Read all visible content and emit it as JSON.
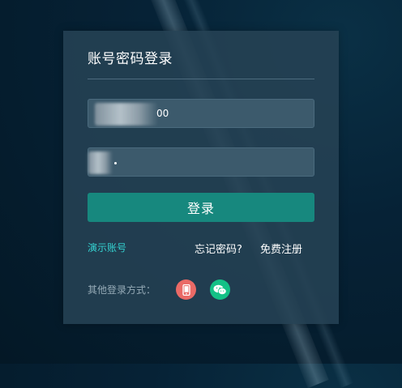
{
  "login": {
    "title": "账号密码登录",
    "username_value": "00",
    "password_value": "",
    "submit_label": "登录",
    "demo_account_label": "演示账号",
    "forgot_password_label": "忘记密码?",
    "register_label": "免费注册",
    "other_methods_label": "其他登录方式："
  },
  "icons": {
    "phone": "mobile-phone-icon",
    "wechat": "wechat-icon"
  },
  "colors": {
    "accent": "#17887e",
    "link": "#34d0cf",
    "phone_icon_bg": "#ea6a66",
    "wechat_icon_bg": "#14c186"
  }
}
